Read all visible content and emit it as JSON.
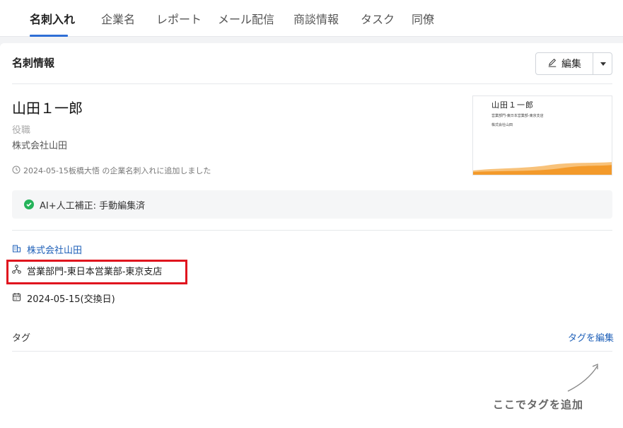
{
  "tabs": [
    {
      "label": "名刺入れ",
      "active": true
    },
    {
      "label": "企業名",
      "active": false
    },
    {
      "label": "レポート",
      "active": false
    },
    {
      "label": "メール配信",
      "active": false
    },
    {
      "label": "商談情報",
      "active": false
    },
    {
      "label": "タスク",
      "active": false
    },
    {
      "label": "同僚",
      "active": false
    }
  ],
  "card": {
    "title": "名刺情報",
    "edit_label": "編集",
    "edit_icon": "pencil-icon",
    "name": "山田１一郎",
    "role": "役職",
    "company": "株式会社山田",
    "added_note": "2024-05-15板橋大悟 の企業名刺入れに追加しました",
    "thumbnail": {
      "name": "山田１一郎",
      "line1": "営業部門-東日本営業部-東京支店",
      "line2": "株式会社山田"
    },
    "ai_status": "AI+人工補正: 手動編集済",
    "details": {
      "company_link": "株式会社山田",
      "department": "営業部門-東日本営業部-東京支店",
      "exchange_date": "2024-05-15(交換日)"
    },
    "tags": {
      "label": "タグ",
      "edit_label": "タグを編集"
    }
  },
  "annotation": {
    "hint": "ここでタグを追加"
  },
  "colors": {
    "accent": "#2f6fd6",
    "link": "#1d5fb8",
    "success": "#25b35a",
    "highlight": "#e0141e",
    "wave": "#f39a2b"
  }
}
